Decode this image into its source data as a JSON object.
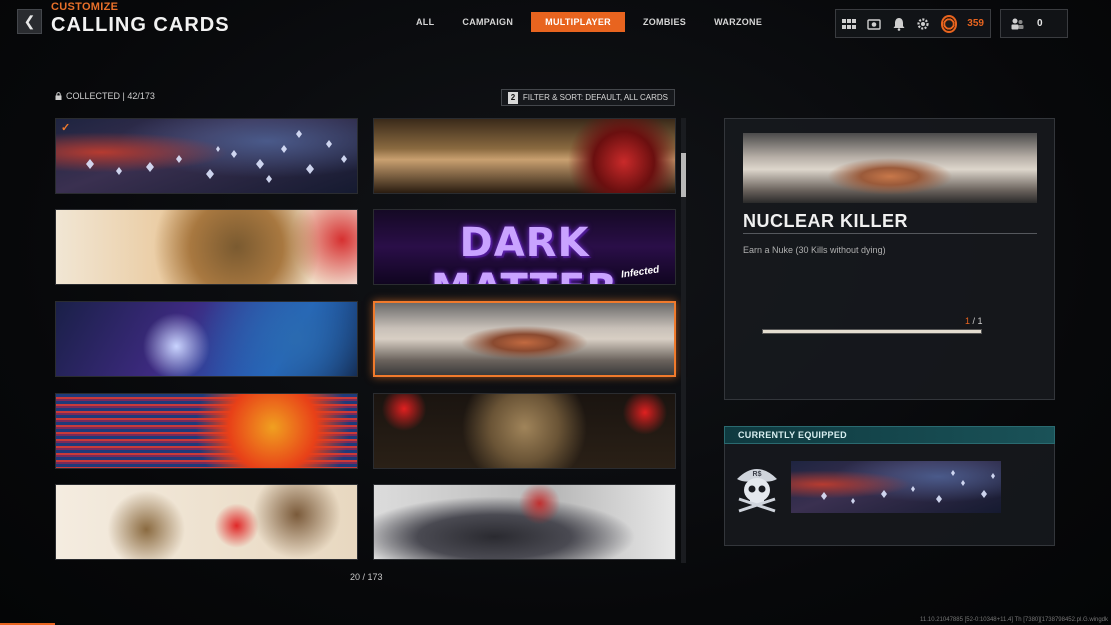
{
  "header": {
    "eyebrow": "CUSTOMIZE",
    "title": "CALLING CARDS",
    "back_icon": "chevron-left-icon"
  },
  "tabs": [
    {
      "label": "ALL",
      "active": false
    },
    {
      "label": "CAMPAIGN",
      "active": false
    },
    {
      "label": "MULTIPLAYER",
      "active": true
    },
    {
      "label": "ZOMBIES",
      "active": false
    },
    {
      "label": "WARZONE",
      "active": false
    }
  ],
  "topbar": {
    "icons": [
      "grid-icon",
      "camera-icon",
      "bell-icon",
      "gear-icon",
      "prestige-badge-icon"
    ],
    "level": "359",
    "friends_icon": "friends-icon",
    "friends_count": "0"
  },
  "collection": {
    "collected_text": "COLLECTED | 42/173",
    "filter_key": "2",
    "filter_text": "FILTER & SORT: DEFAULT, ALL CARDS"
  },
  "cards": [
    {
      "id": "diamonds",
      "equipped": true
    },
    {
      "id": "red-eye-soldier"
    },
    {
      "id": "skull-gunfire"
    },
    {
      "id": "dark-matter",
      "title": "DARK MATTER",
      "subtitle": "Infected"
    },
    {
      "id": "skeleton-soldier"
    },
    {
      "id": "nuclear-killer",
      "selected": true
    },
    {
      "id": "flaming-skull-rifle"
    },
    {
      "id": "soldier-rifle"
    },
    {
      "id": "helmets-splatter"
    },
    {
      "id": "anime-girl"
    }
  ],
  "pagination": "20 / 173",
  "detail": {
    "name": "NUCLEAR KILLER",
    "description": "Earn a Nuke (30 Kills without dying)",
    "progress_current": "1",
    "progress_sep": " / ",
    "progress_total": "1",
    "progress_fraction": 1.0
  },
  "equipped": {
    "header": "CURRENTLY EQUIPPED",
    "emblem_icon": "pirate-skull-emblem-icon"
  },
  "footer_id": "11.10.21047885 [52-0:10348+11.4] Th [7380][1738798452.pl.G.wingdk"
}
